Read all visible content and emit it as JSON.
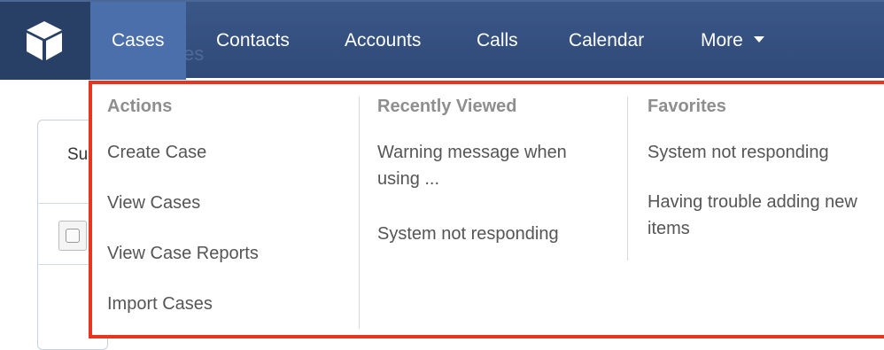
{
  "nav": {
    "items": [
      {
        "label": "Cases",
        "active": true
      },
      {
        "label": "Contacts"
      },
      {
        "label": "Accounts"
      },
      {
        "label": "Calls"
      },
      {
        "label": "Calendar"
      },
      {
        "label": "More"
      }
    ],
    "ghost_text": "es"
  },
  "background": {
    "tab_fragment": "Su"
  },
  "dropdown": {
    "border_color": "#e8351f",
    "actions": {
      "heading": "Actions",
      "items": [
        "Create Case",
        "View Cases",
        "View Case Reports",
        "Import Cases"
      ]
    },
    "recently_viewed": {
      "heading": "Recently Viewed",
      "items": [
        "Warning message when using ...",
        "System not responding"
      ]
    },
    "favorites": {
      "heading": "Favorites",
      "items": [
        "System not responding",
        "Having trouble adding new items"
      ]
    }
  },
  "colors": {
    "navbar": "#2f4a78",
    "active_tab": "#4a6fab",
    "logo_bg": "#283f66"
  }
}
